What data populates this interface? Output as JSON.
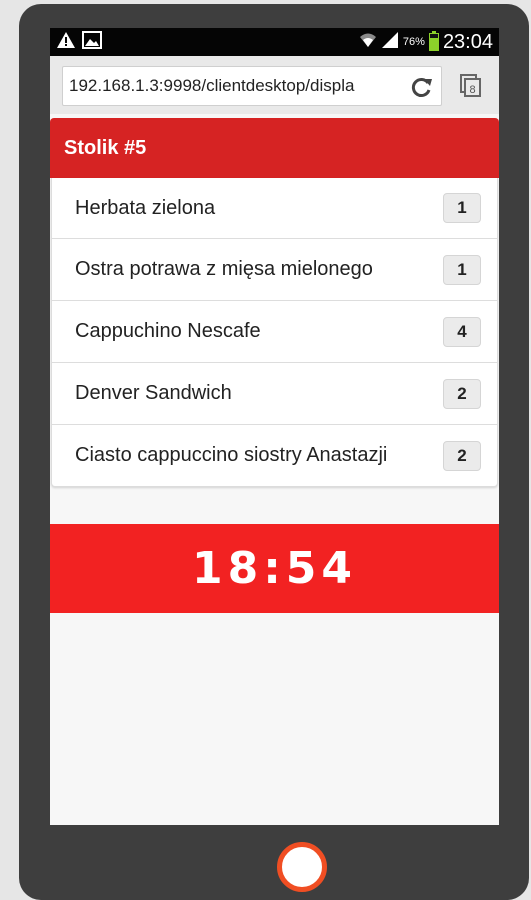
{
  "status_bar": {
    "time": "23:04",
    "battery_percent": "76%",
    "battery_level": 0.76,
    "icons": [
      "warning-icon",
      "image-notification-icon",
      "wifi-icon",
      "signal-icon",
      "battery-icon"
    ]
  },
  "browser": {
    "url": "192.168.1.3:9998/clientdesktop/displa",
    "tab_count": "8",
    "icons": [
      "reload-icon",
      "tabs-icon"
    ]
  },
  "order": {
    "table_title": "Stolik #5",
    "items": [
      {
        "name": "Herbata zielona",
        "qty": "1"
      },
      {
        "name": "Ostra potrawa z mięsa mielonego",
        "qty": "1"
      },
      {
        "name": "Cappuchino Nescafe",
        "qty": "4"
      },
      {
        "name": "Denver Sandwich",
        "qty": "2"
      },
      {
        "name": "Ciasto cappuccino siostry Anastazji",
        "qty": "2"
      }
    ]
  },
  "timer": {
    "value": "18:54"
  },
  "colors": {
    "header_red": "#d62323",
    "timer_red": "#f22222",
    "home_button_ring": "#f04e23",
    "battery_green": "#8cd12a"
  }
}
